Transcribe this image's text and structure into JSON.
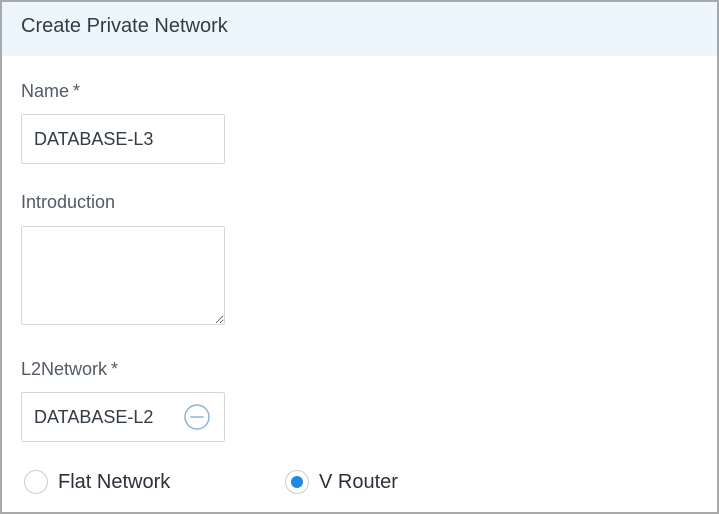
{
  "dialog": {
    "title": "Create Private Network"
  },
  "form": {
    "name": {
      "label": "Name",
      "required_mark": "*",
      "value": "DATABASE-L3"
    },
    "introduction": {
      "label": "Introduction",
      "value": ""
    },
    "l2network": {
      "label": "L2Network",
      "required_mark": "*",
      "selected_value": "DATABASE-L2",
      "action_icon": "minus-circle-icon"
    },
    "network_type": {
      "options": [
        {
          "label": "Flat Network",
          "checked": false
        },
        {
          "label": "V Router",
          "checked": true
        }
      ]
    }
  },
  "colors": {
    "header_background": "#eef6fd",
    "accent": "#1e88e5",
    "border": "#d4d8de"
  }
}
